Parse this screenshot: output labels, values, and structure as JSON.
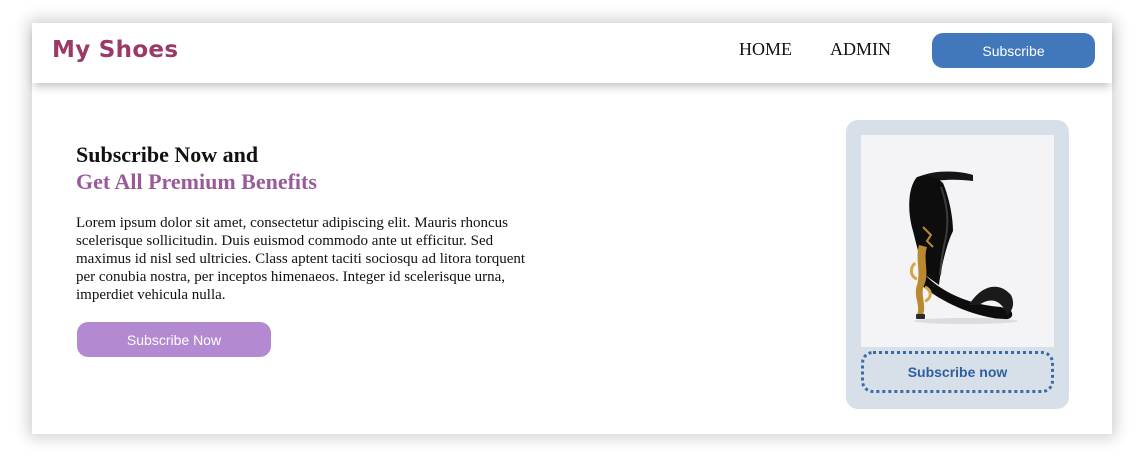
{
  "header": {
    "logo": "My Shoes",
    "nav": {
      "home": "HOME",
      "admin": "ADMIN"
    },
    "subscribe_label": "Subscribe"
  },
  "hero": {
    "title_line1": "Subscribe Now and",
    "title_line2": "Get All Premium Benefits",
    "body": "Lorem ipsum dolor sit amet, consectetur adipiscing elit. Mauris rhoncus scelerisque sollicitudin. Duis euismod commodo ante ut efficitur. Sed maximus id nisl sed ultricies. Class aptent taciti sociosqu ad litora torquent per conubia nostra, per inceptos himenaeos. Integer id scelerisque urna, imperdiet vehicula nulla.",
    "button_label": "Subscribe Now"
  },
  "card": {
    "image_icon": "high-heel-sandal-icon",
    "button_label": "Subscribe now"
  },
  "colors": {
    "logo": "#9b3a68",
    "header_button": "#4178bc",
    "title_accent": "#9a5a9a",
    "hero_button": "#b38ad1",
    "card_background": "#d7dfe9",
    "card_button_text": "#2f5f9c"
  }
}
